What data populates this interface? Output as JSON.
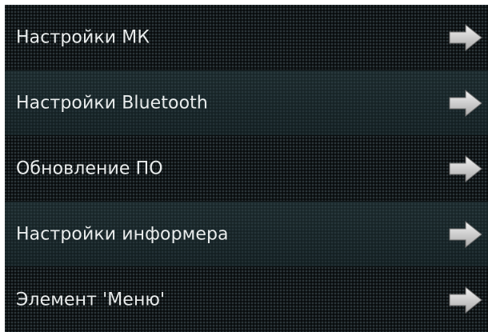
{
  "menu": {
    "items": [
      {
        "label": "Настройки МК",
        "icon": "arrow-right-icon"
      },
      {
        "label": "Настройки Bluetooth",
        "icon": "arrow-right-icon"
      },
      {
        "label": "Обновление ПО",
        "icon": "arrow-right-icon"
      },
      {
        "label": "Настройки информера",
        "icon": "arrow-right-icon"
      },
      {
        "label": "Элемент 'Меню'",
        "icon": "arrow-right-icon"
      }
    ]
  },
  "colors": {
    "background": "#111719",
    "row_highlight": "#1f3336",
    "text": "#e9ecec",
    "arrow": "#d4d4d4"
  }
}
